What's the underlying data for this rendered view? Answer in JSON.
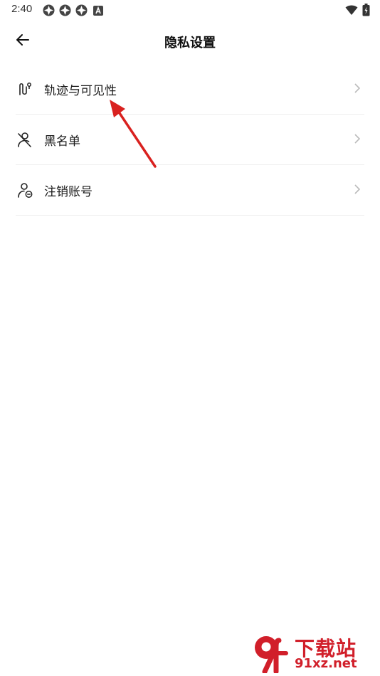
{
  "status_bar": {
    "time": "2:40",
    "left_icons": [
      "app-notification-icon",
      "app-notification-icon",
      "app-notification-icon",
      "a-icon"
    ],
    "right_icons": [
      "wifi-icon",
      "battery-icon"
    ]
  },
  "header": {
    "title": "隐私设置",
    "back_icon": "arrow-left-icon"
  },
  "menu": {
    "items": [
      {
        "label": "轨迹与可见性",
        "icon": "route-icon"
      },
      {
        "label": "黑名单",
        "icon": "blocked-user-icon"
      },
      {
        "label": "注销账号",
        "icon": "remove-user-icon"
      }
    ]
  },
  "watermark": {
    "top": "下载站",
    "bottom": "91xz.net",
    "logo": "9f"
  },
  "colors": {
    "arrow": "#d9211f",
    "watermark": "#d11f2a",
    "divider": "#eeeeee",
    "chevron": "#bbbbbb"
  }
}
